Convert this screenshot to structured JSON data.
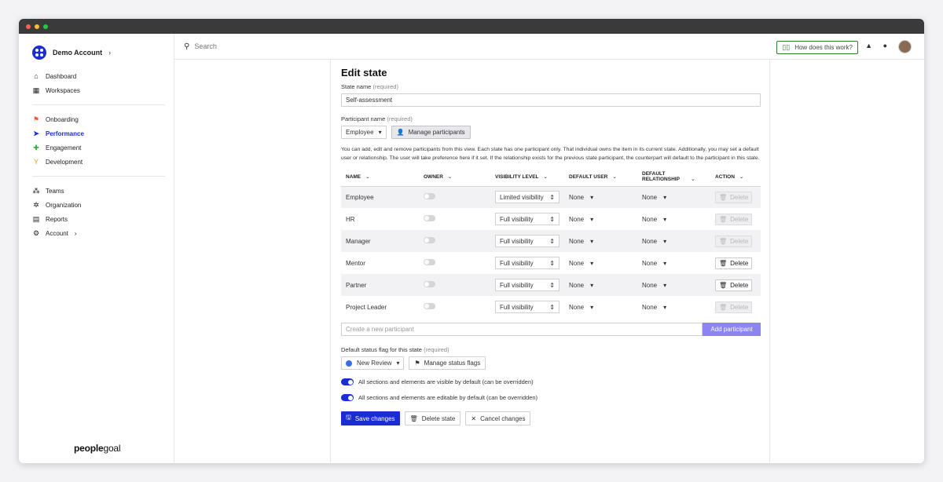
{
  "sidebar": {
    "account": "Demo Account",
    "items_top": [
      {
        "label": "Dashboard",
        "icon": "home-icon"
      },
      {
        "label": "Workspaces",
        "icon": "grid-icon"
      }
    ],
    "items_apps": [
      {
        "label": "Onboarding",
        "icon": "flag-icon"
      },
      {
        "label": "Performance",
        "icon": "paper-plane-icon"
      },
      {
        "label": "Engagement",
        "icon": "puzzle-icon"
      },
      {
        "label": "Development",
        "icon": "sprout-icon"
      }
    ],
    "items_admin": [
      {
        "label": "Teams",
        "icon": "teams-icon"
      },
      {
        "label": "Organization",
        "icon": "org-icon"
      },
      {
        "label": "Reports",
        "icon": "reports-icon"
      },
      {
        "label": "Account",
        "icon": "gear-icon"
      }
    ],
    "brand_bold": "people",
    "brand_light": "goal"
  },
  "topbar": {
    "search_placeholder": "Search",
    "help_label": "How does this work?"
  },
  "form": {
    "title": "Edit state",
    "state_label": "State name",
    "required": "(required)",
    "state_value": "Self-assessment",
    "participant_label": "Participant name",
    "participant_value": "Employee",
    "manage_participants": "Manage participants",
    "help_text": "You can add, edit and remove participants from this view. Each state has one participant only. That individual owns the item in its current state. Additionally, you may set a default user or relationship. The user will take preference here if it set. If the relationship exists for the previous state participant, the counterpart will default to the participant in this state.",
    "columns": [
      "NAME",
      "OWNER",
      "VISIBILITY LEVEL",
      "DEFAULT USER",
      "DEFAULT RELATIONSHIP",
      "ACTION"
    ],
    "rows": [
      {
        "name": "Employee",
        "visibility": "Limited visibility",
        "user": "None",
        "relationship": "None",
        "action": "Delete",
        "delete_enabled": false
      },
      {
        "name": "HR",
        "visibility": "Full visibility",
        "user": "None",
        "relationship": "None",
        "action": "Delete",
        "delete_enabled": false
      },
      {
        "name": "Manager",
        "visibility": "Full visibility",
        "user": "None",
        "relationship": "None",
        "action": "Delete",
        "delete_enabled": false
      },
      {
        "name": "Mentor",
        "visibility": "Full visibility",
        "user": "None",
        "relationship": "None",
        "action": "Delete",
        "delete_enabled": true
      },
      {
        "name": "Partner",
        "visibility": "Full visibility",
        "user": "None",
        "relationship": "None",
        "action": "Delete",
        "delete_enabled": true
      },
      {
        "name": "Project Leader",
        "visibility": "Full visibility",
        "user": "None",
        "relationship": "None",
        "action": "Delete",
        "delete_enabled": false
      }
    ],
    "new_participant_placeholder": "Create a new participant",
    "add_participant": "Add participant",
    "status_label": "Default status flag for this state",
    "status_value": "New Review",
    "manage_flags": "Manage status flags",
    "visible_default": "All sections and elements are visible by default (can be overridden)",
    "editable_default": "All sections and elements are editable by default (can be overridden)",
    "save": "Save changes",
    "delete_state": "Delete state",
    "cancel": "Cancel changes"
  },
  "colors": {
    "accent": "#1a2bd8",
    "add_button": "#8c84f0",
    "status_dot": "#3a6ee8",
    "help_border": "#2e7d32"
  }
}
